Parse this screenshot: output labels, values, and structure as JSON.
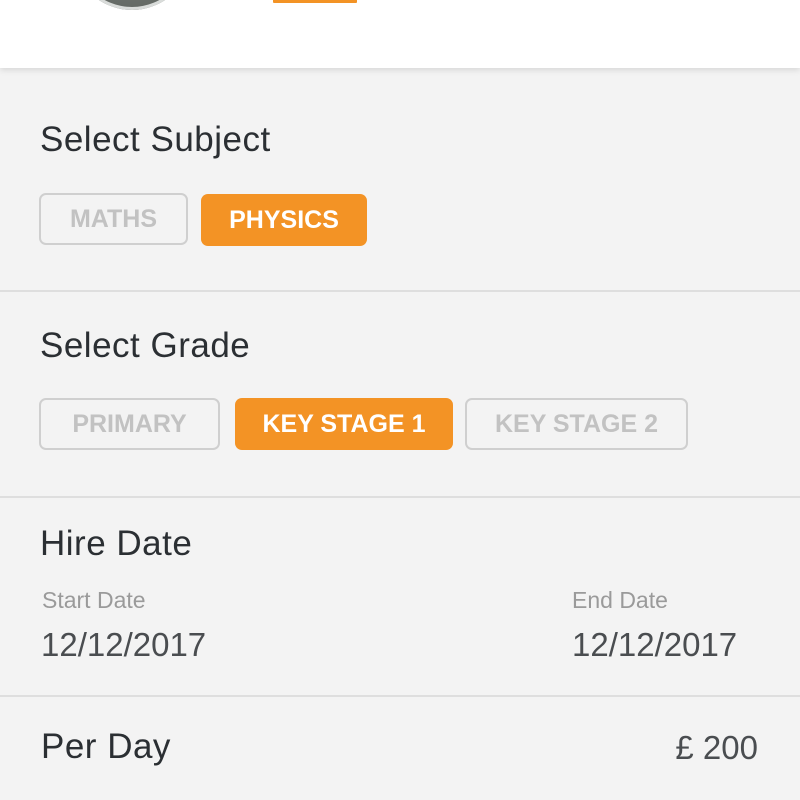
{
  "subject": {
    "title": "Select Subject",
    "options": [
      {
        "label": "MATHS",
        "selected": false
      },
      {
        "label": "PHYSICS",
        "selected": true
      }
    ]
  },
  "grade": {
    "title": "Select Grade",
    "options": [
      {
        "label": "PRIMARY",
        "selected": false
      },
      {
        "label": "KEY STAGE 1",
        "selected": true
      },
      {
        "label": "KEY STAGE 2",
        "selected": false
      }
    ]
  },
  "hire_date": {
    "title": "Hire Date",
    "start_label": "Start Date",
    "start_value": "12/12/2017",
    "end_label": "End Date",
    "end_value": "12/12/2017"
  },
  "rate": {
    "label": "Per Day",
    "value": "£ 200"
  },
  "colors": {
    "accent": "#f39325",
    "background": "#f3f3f3",
    "chip_border": "#cfcfcf",
    "chip_text_inactive": "#c2c2c2"
  },
  "icons": {
    "profile": "avatar"
  }
}
